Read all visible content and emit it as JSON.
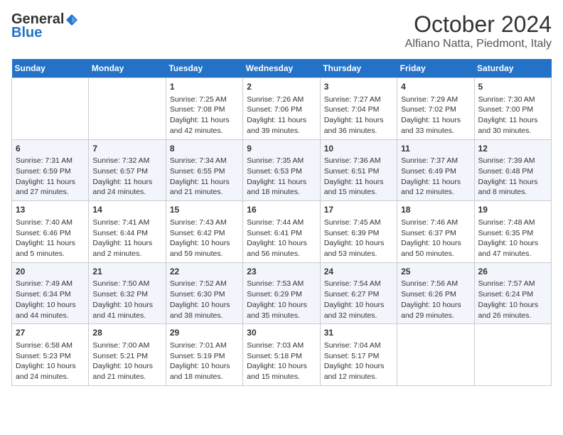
{
  "header": {
    "logo_general": "General",
    "logo_blue": "Blue",
    "month_title": "October 2024",
    "location": "Alfiano Natta, Piedmont, Italy"
  },
  "weekdays": [
    "Sunday",
    "Monday",
    "Tuesday",
    "Wednesday",
    "Thursday",
    "Friday",
    "Saturday"
  ],
  "weeks": [
    [
      {
        "day": "",
        "content": ""
      },
      {
        "day": "",
        "content": ""
      },
      {
        "day": "1",
        "content": "Sunrise: 7:25 AM\nSunset: 7:08 PM\nDaylight: 11 hours and 42 minutes."
      },
      {
        "day": "2",
        "content": "Sunrise: 7:26 AM\nSunset: 7:06 PM\nDaylight: 11 hours and 39 minutes."
      },
      {
        "day": "3",
        "content": "Sunrise: 7:27 AM\nSunset: 7:04 PM\nDaylight: 11 hours and 36 minutes."
      },
      {
        "day": "4",
        "content": "Sunrise: 7:29 AM\nSunset: 7:02 PM\nDaylight: 11 hours and 33 minutes."
      },
      {
        "day": "5",
        "content": "Sunrise: 7:30 AM\nSunset: 7:00 PM\nDaylight: 11 hours and 30 minutes."
      }
    ],
    [
      {
        "day": "6",
        "content": "Sunrise: 7:31 AM\nSunset: 6:59 PM\nDaylight: 11 hours and 27 minutes."
      },
      {
        "day": "7",
        "content": "Sunrise: 7:32 AM\nSunset: 6:57 PM\nDaylight: 11 hours and 24 minutes."
      },
      {
        "day": "8",
        "content": "Sunrise: 7:34 AM\nSunset: 6:55 PM\nDaylight: 11 hours and 21 minutes."
      },
      {
        "day": "9",
        "content": "Sunrise: 7:35 AM\nSunset: 6:53 PM\nDaylight: 11 hours and 18 minutes."
      },
      {
        "day": "10",
        "content": "Sunrise: 7:36 AM\nSunset: 6:51 PM\nDaylight: 11 hours and 15 minutes."
      },
      {
        "day": "11",
        "content": "Sunrise: 7:37 AM\nSunset: 6:49 PM\nDaylight: 11 hours and 12 minutes."
      },
      {
        "day": "12",
        "content": "Sunrise: 7:39 AM\nSunset: 6:48 PM\nDaylight: 11 hours and 8 minutes."
      }
    ],
    [
      {
        "day": "13",
        "content": "Sunrise: 7:40 AM\nSunset: 6:46 PM\nDaylight: 11 hours and 5 minutes."
      },
      {
        "day": "14",
        "content": "Sunrise: 7:41 AM\nSunset: 6:44 PM\nDaylight: 11 hours and 2 minutes."
      },
      {
        "day": "15",
        "content": "Sunrise: 7:43 AM\nSunset: 6:42 PM\nDaylight: 10 hours and 59 minutes."
      },
      {
        "day": "16",
        "content": "Sunrise: 7:44 AM\nSunset: 6:41 PM\nDaylight: 10 hours and 56 minutes."
      },
      {
        "day": "17",
        "content": "Sunrise: 7:45 AM\nSunset: 6:39 PM\nDaylight: 10 hours and 53 minutes."
      },
      {
        "day": "18",
        "content": "Sunrise: 7:46 AM\nSunset: 6:37 PM\nDaylight: 10 hours and 50 minutes."
      },
      {
        "day": "19",
        "content": "Sunrise: 7:48 AM\nSunset: 6:35 PM\nDaylight: 10 hours and 47 minutes."
      }
    ],
    [
      {
        "day": "20",
        "content": "Sunrise: 7:49 AM\nSunset: 6:34 PM\nDaylight: 10 hours and 44 minutes."
      },
      {
        "day": "21",
        "content": "Sunrise: 7:50 AM\nSunset: 6:32 PM\nDaylight: 10 hours and 41 minutes."
      },
      {
        "day": "22",
        "content": "Sunrise: 7:52 AM\nSunset: 6:30 PM\nDaylight: 10 hours and 38 minutes."
      },
      {
        "day": "23",
        "content": "Sunrise: 7:53 AM\nSunset: 6:29 PM\nDaylight: 10 hours and 35 minutes."
      },
      {
        "day": "24",
        "content": "Sunrise: 7:54 AM\nSunset: 6:27 PM\nDaylight: 10 hours and 32 minutes."
      },
      {
        "day": "25",
        "content": "Sunrise: 7:56 AM\nSunset: 6:26 PM\nDaylight: 10 hours and 29 minutes."
      },
      {
        "day": "26",
        "content": "Sunrise: 7:57 AM\nSunset: 6:24 PM\nDaylight: 10 hours and 26 minutes."
      }
    ],
    [
      {
        "day": "27",
        "content": "Sunrise: 6:58 AM\nSunset: 5:23 PM\nDaylight: 10 hours and 24 minutes."
      },
      {
        "day": "28",
        "content": "Sunrise: 7:00 AM\nSunset: 5:21 PM\nDaylight: 10 hours and 21 minutes."
      },
      {
        "day": "29",
        "content": "Sunrise: 7:01 AM\nSunset: 5:19 PM\nDaylight: 10 hours and 18 minutes."
      },
      {
        "day": "30",
        "content": "Sunrise: 7:03 AM\nSunset: 5:18 PM\nDaylight: 10 hours and 15 minutes."
      },
      {
        "day": "31",
        "content": "Sunrise: 7:04 AM\nSunset: 5:17 PM\nDaylight: 10 hours and 12 minutes."
      },
      {
        "day": "",
        "content": ""
      },
      {
        "day": "",
        "content": ""
      }
    ]
  ]
}
